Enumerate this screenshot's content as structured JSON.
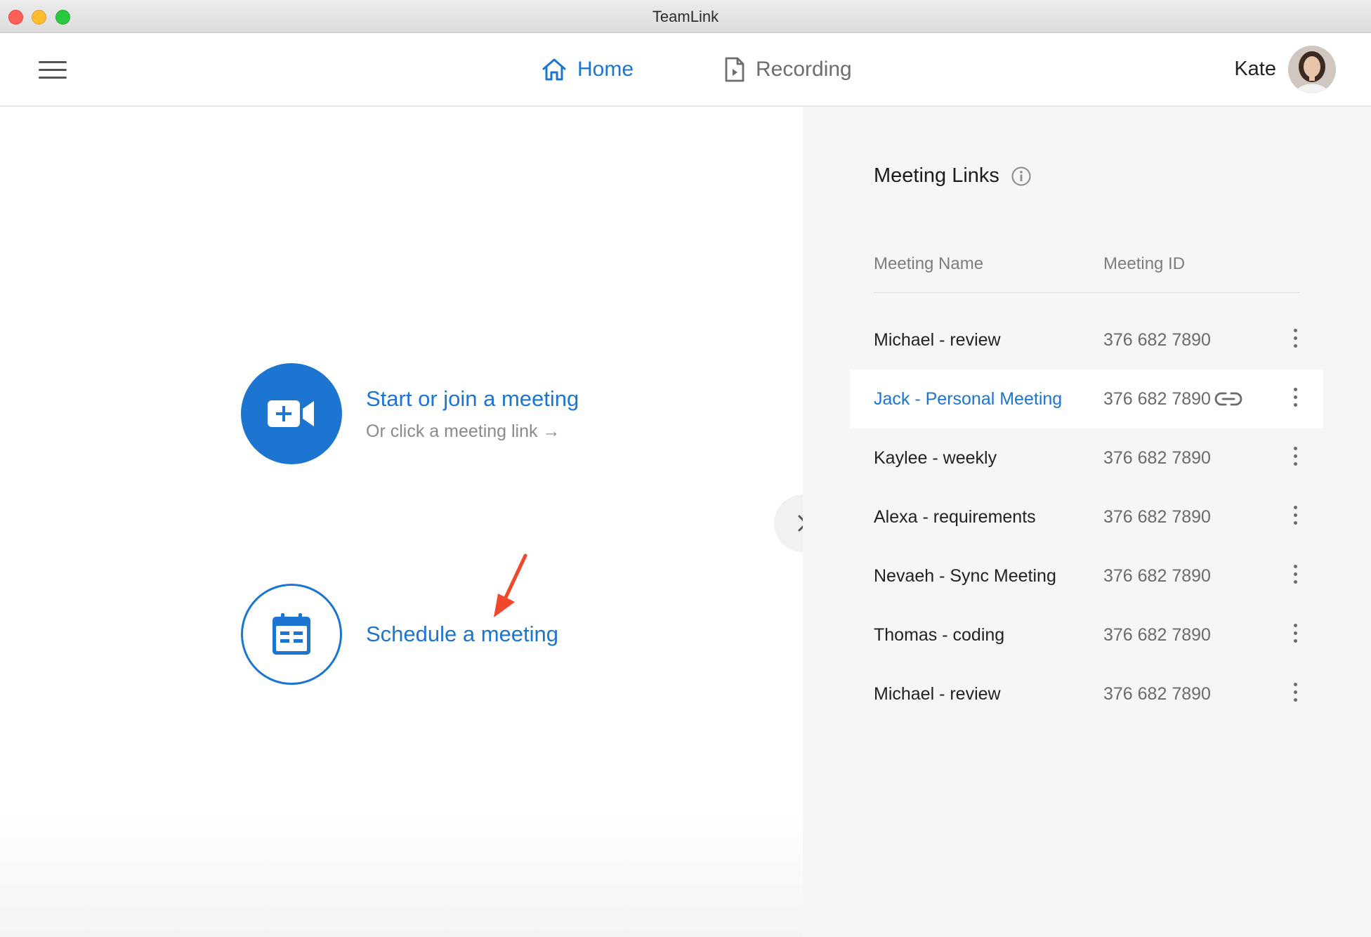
{
  "window": {
    "title": "TeamLink"
  },
  "header": {
    "nav": {
      "home_label": "Home",
      "recording_label": "Recording"
    },
    "user_name": "Kate"
  },
  "actions": {
    "start": {
      "title": "Start or join a meeting",
      "subtitle": "Or click a meeting link →"
    },
    "schedule": {
      "title": "Schedule a meeting"
    }
  },
  "meeting_links": {
    "title": "Meeting Links",
    "columns": {
      "name": "Meeting Name",
      "id": "Meeting ID"
    },
    "rows": [
      {
        "name": "Michael - review",
        "id": "376 682 7890"
      },
      {
        "name": "Jack - Personal Meeting",
        "id": "376 682 7890"
      },
      {
        "name": "Kaylee - weekly",
        "id": "376 682 7890"
      },
      {
        "name": "Alexa - requirements",
        "id": "376 682 7890"
      },
      {
        "name": "Nevaeh - Sync Meeting",
        "id": "376 682 7890"
      },
      {
        "name": "Thomas - coding",
        "id": "376 682 7890"
      },
      {
        "name": "Michael - review",
        "id": "376 682 7890"
      }
    ]
  },
  "colors": {
    "accent": "#1c75d1",
    "annotation_arrow": "#f2472b"
  }
}
